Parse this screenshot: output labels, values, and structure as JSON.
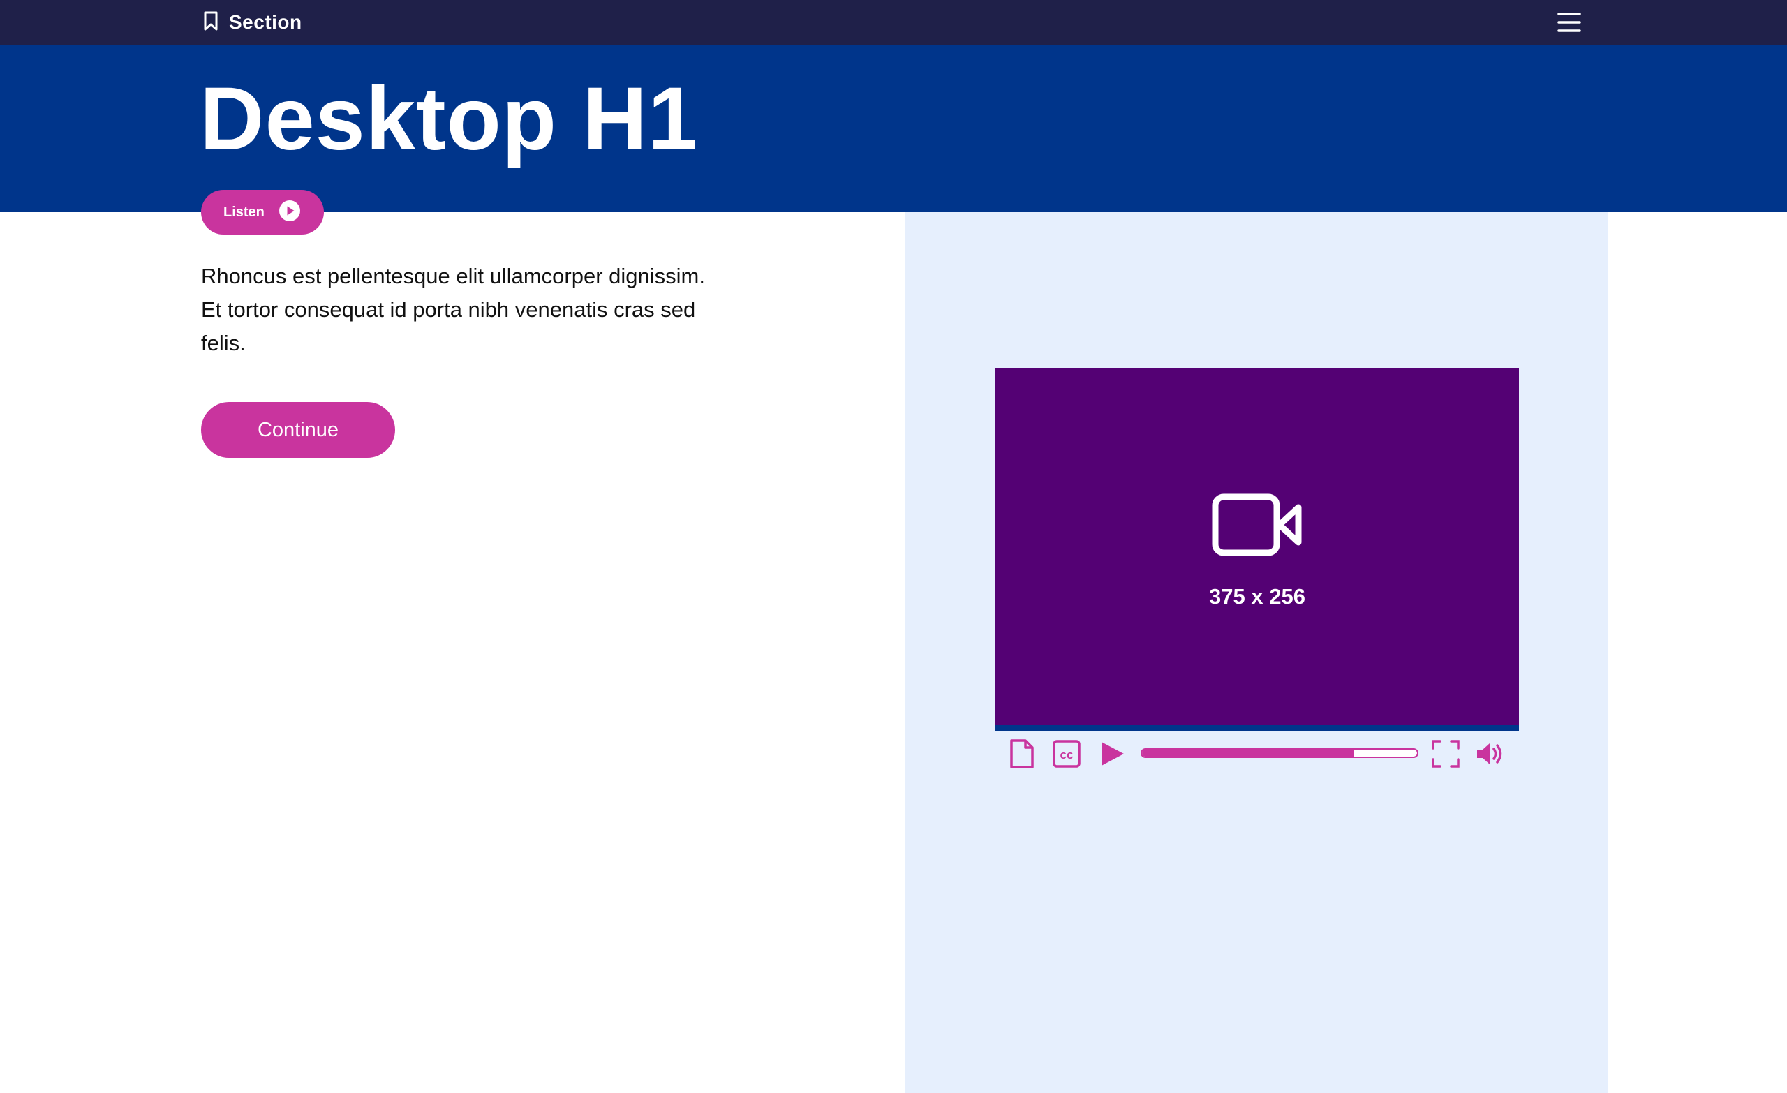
{
  "topbar": {
    "section_label": "Section",
    "bookmark_icon": "bookmark-icon",
    "menu_icon": "hamburger-menu-icon"
  },
  "hero": {
    "title": "Desktop H1"
  },
  "listen": {
    "label": "Listen",
    "icon": "play-circle-icon"
  },
  "content": {
    "body": "Rhoncus est pellentesque elit ullamcorper dignissim. Et tortor consequat id porta nibh venenatis cras sed felis.",
    "continue_label": "Continue"
  },
  "video": {
    "placeholder_icon": "video-camera-icon",
    "dimensions_label": "375 x 256",
    "progress_fraction": 0.77,
    "controls": [
      "transcript-icon",
      "closed-captions-icon",
      "play-icon",
      "fullscreen-icon",
      "volume-icon"
    ],
    "cc_text": "cc"
  },
  "colors": {
    "topbar": "#1f2049",
    "hero": "#00358b",
    "accent": "#c9349e",
    "media_panel": "#e6effd",
    "video_bg": "#540174"
  }
}
